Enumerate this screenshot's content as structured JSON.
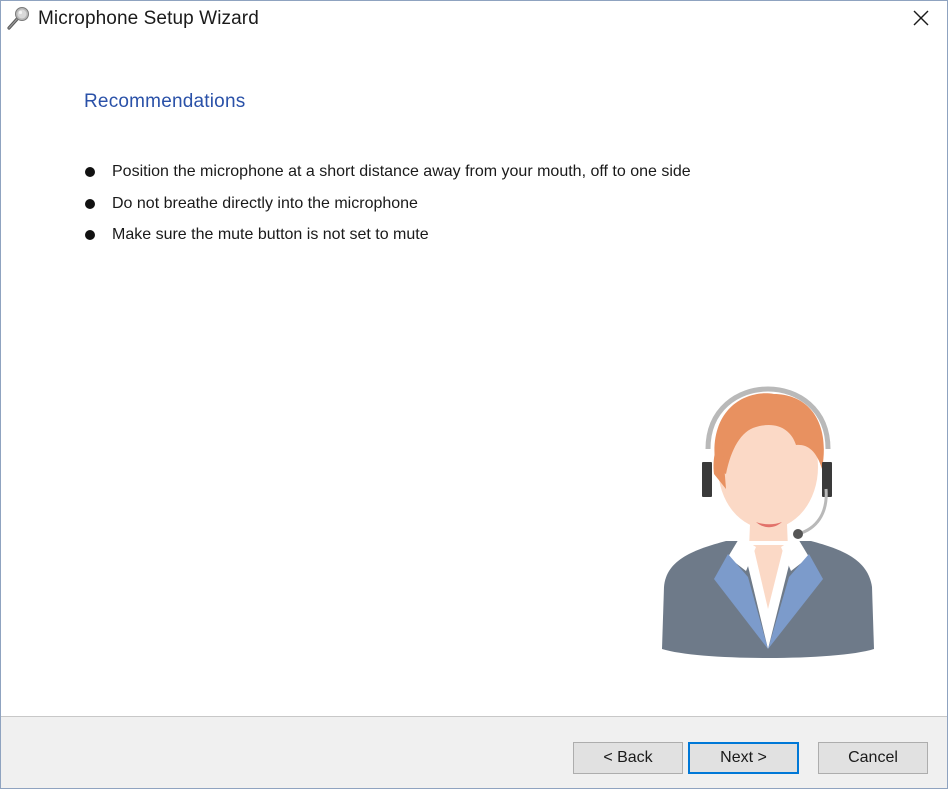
{
  "window": {
    "title": "Microphone Setup Wizard",
    "icon": "microphone-icon",
    "close_icon": "close-icon"
  },
  "content": {
    "heading": "Recommendations",
    "recommendations": [
      "Position the microphone at a short distance away from your mouth, off to one side",
      "Do not breathe directly into the microphone",
      "Make sure the mute button is not set to mute"
    ],
    "illustration": "headset-operator-illustration"
  },
  "footer": {
    "back_label": "< Back",
    "next_label": "Next >",
    "cancel_label": "Cancel"
  },
  "colors": {
    "heading": "#2a51a8",
    "focus_border": "#0078d7",
    "footer_bg": "#f0f0f0"
  }
}
